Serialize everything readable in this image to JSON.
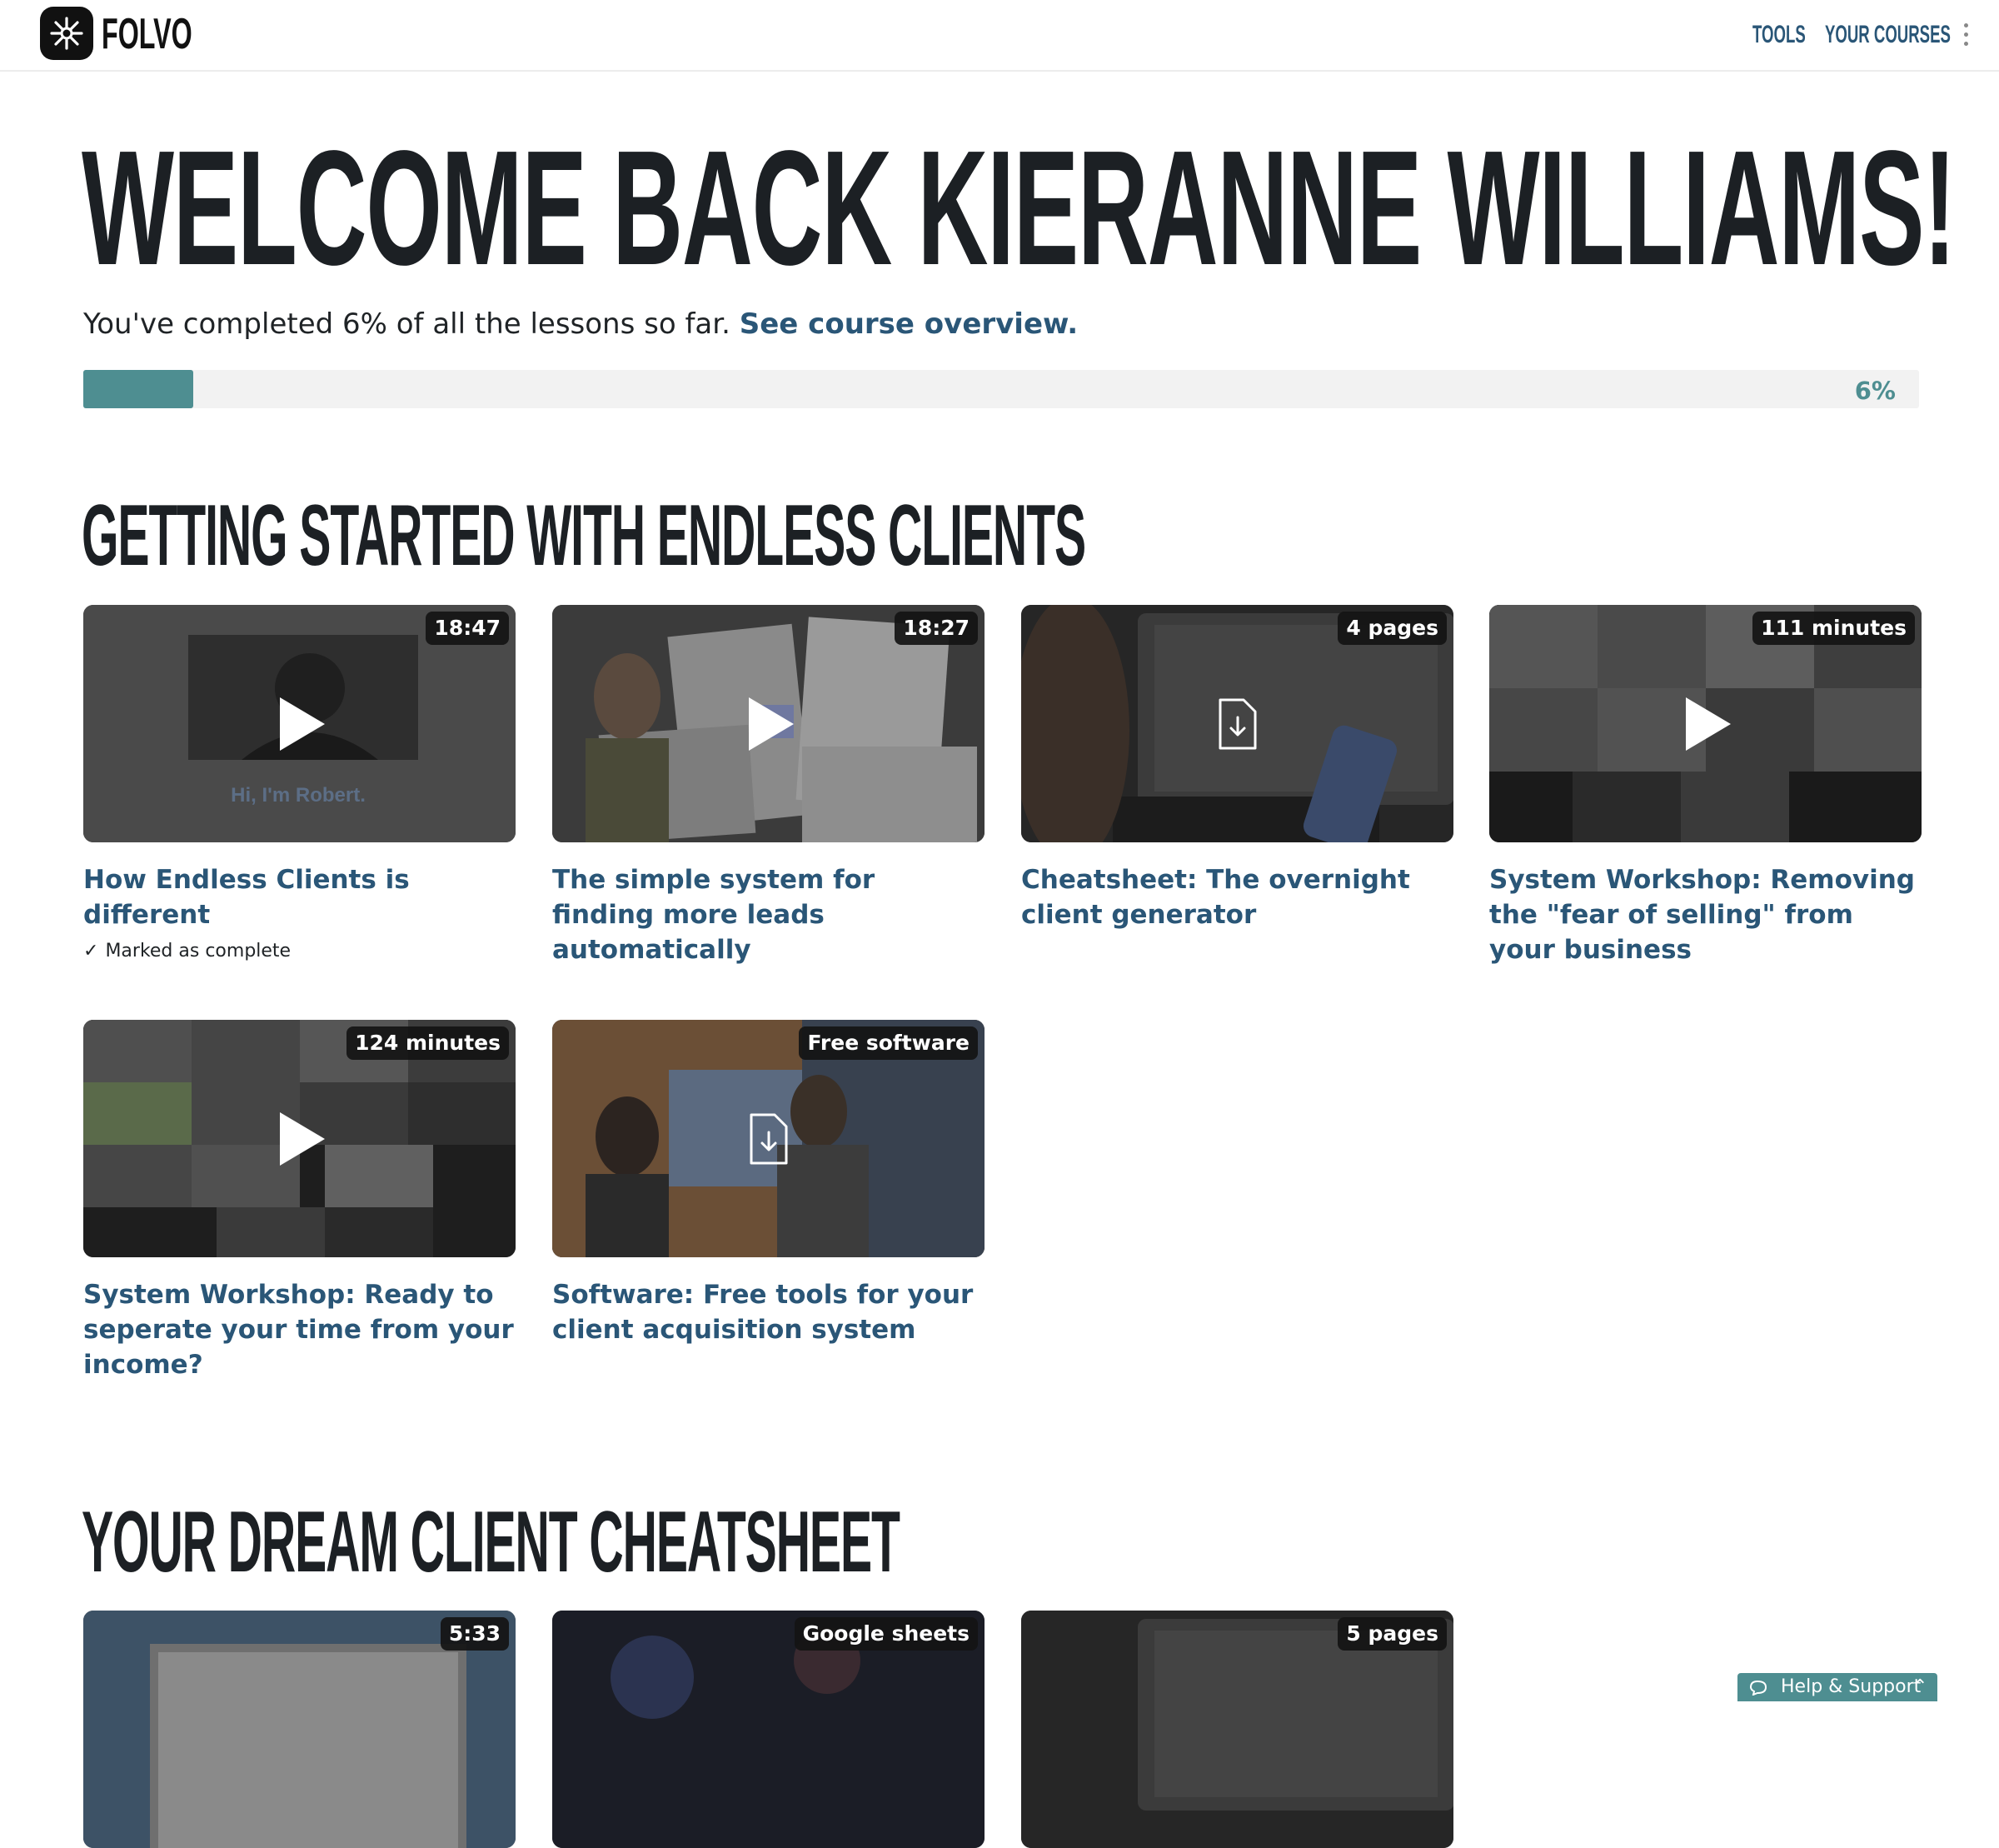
{
  "header": {
    "logo_text": "FOLVO",
    "nav": [
      {
        "label": "TOOLS"
      },
      {
        "label": "YOUR COURSES"
      }
    ]
  },
  "hero": {
    "title": "WELCOME BACK KIERANNE WILLIAMS!",
    "subtitle_text": "You've completed 6% of all the lessons so far.",
    "subtitle_link": "See course overview.",
    "progress_fraction": 0.06,
    "progress_label": "6%"
  },
  "sections": [
    {
      "title": "GETTING STARTED WITH ENDLESS CLIENTS",
      "cards": [
        {
          "badge": "18:47",
          "title": "How Endless Clients is different",
          "meta": "Marked as complete",
          "kind": "video",
          "thumb_text": "Hi, I'm Robert."
        },
        {
          "badge": "18:27",
          "title": "The simple system for finding more leads automatically",
          "kind": "video"
        },
        {
          "badge": "4 pages",
          "title": "Cheatsheet: The overnight client generator",
          "kind": "document"
        },
        {
          "badge": "111 minutes",
          "title": "System Workshop: Removing the \"fear of selling\" from your business",
          "kind": "video"
        },
        {
          "badge": "124 minutes",
          "title": "System Workshop: Ready to seperate your time from your income?",
          "kind": "video"
        },
        {
          "badge": "Free software",
          "title": "Software: Free tools for your client acquisition system",
          "kind": "document"
        }
      ]
    },
    {
      "title": "YOUR DREAM CLIENT CHEATSHEET",
      "cards": [
        {
          "badge": "5:33",
          "kind": "video"
        },
        {
          "badge": "Google sheets",
          "kind": "document"
        },
        {
          "badge": "5 pages",
          "kind": "document"
        }
      ]
    }
  ],
  "help": {
    "label": "Help & Support"
  },
  "colors": {
    "accent": "#4e8e91",
    "link": "#2a5677",
    "heading": "#1c2024"
  }
}
